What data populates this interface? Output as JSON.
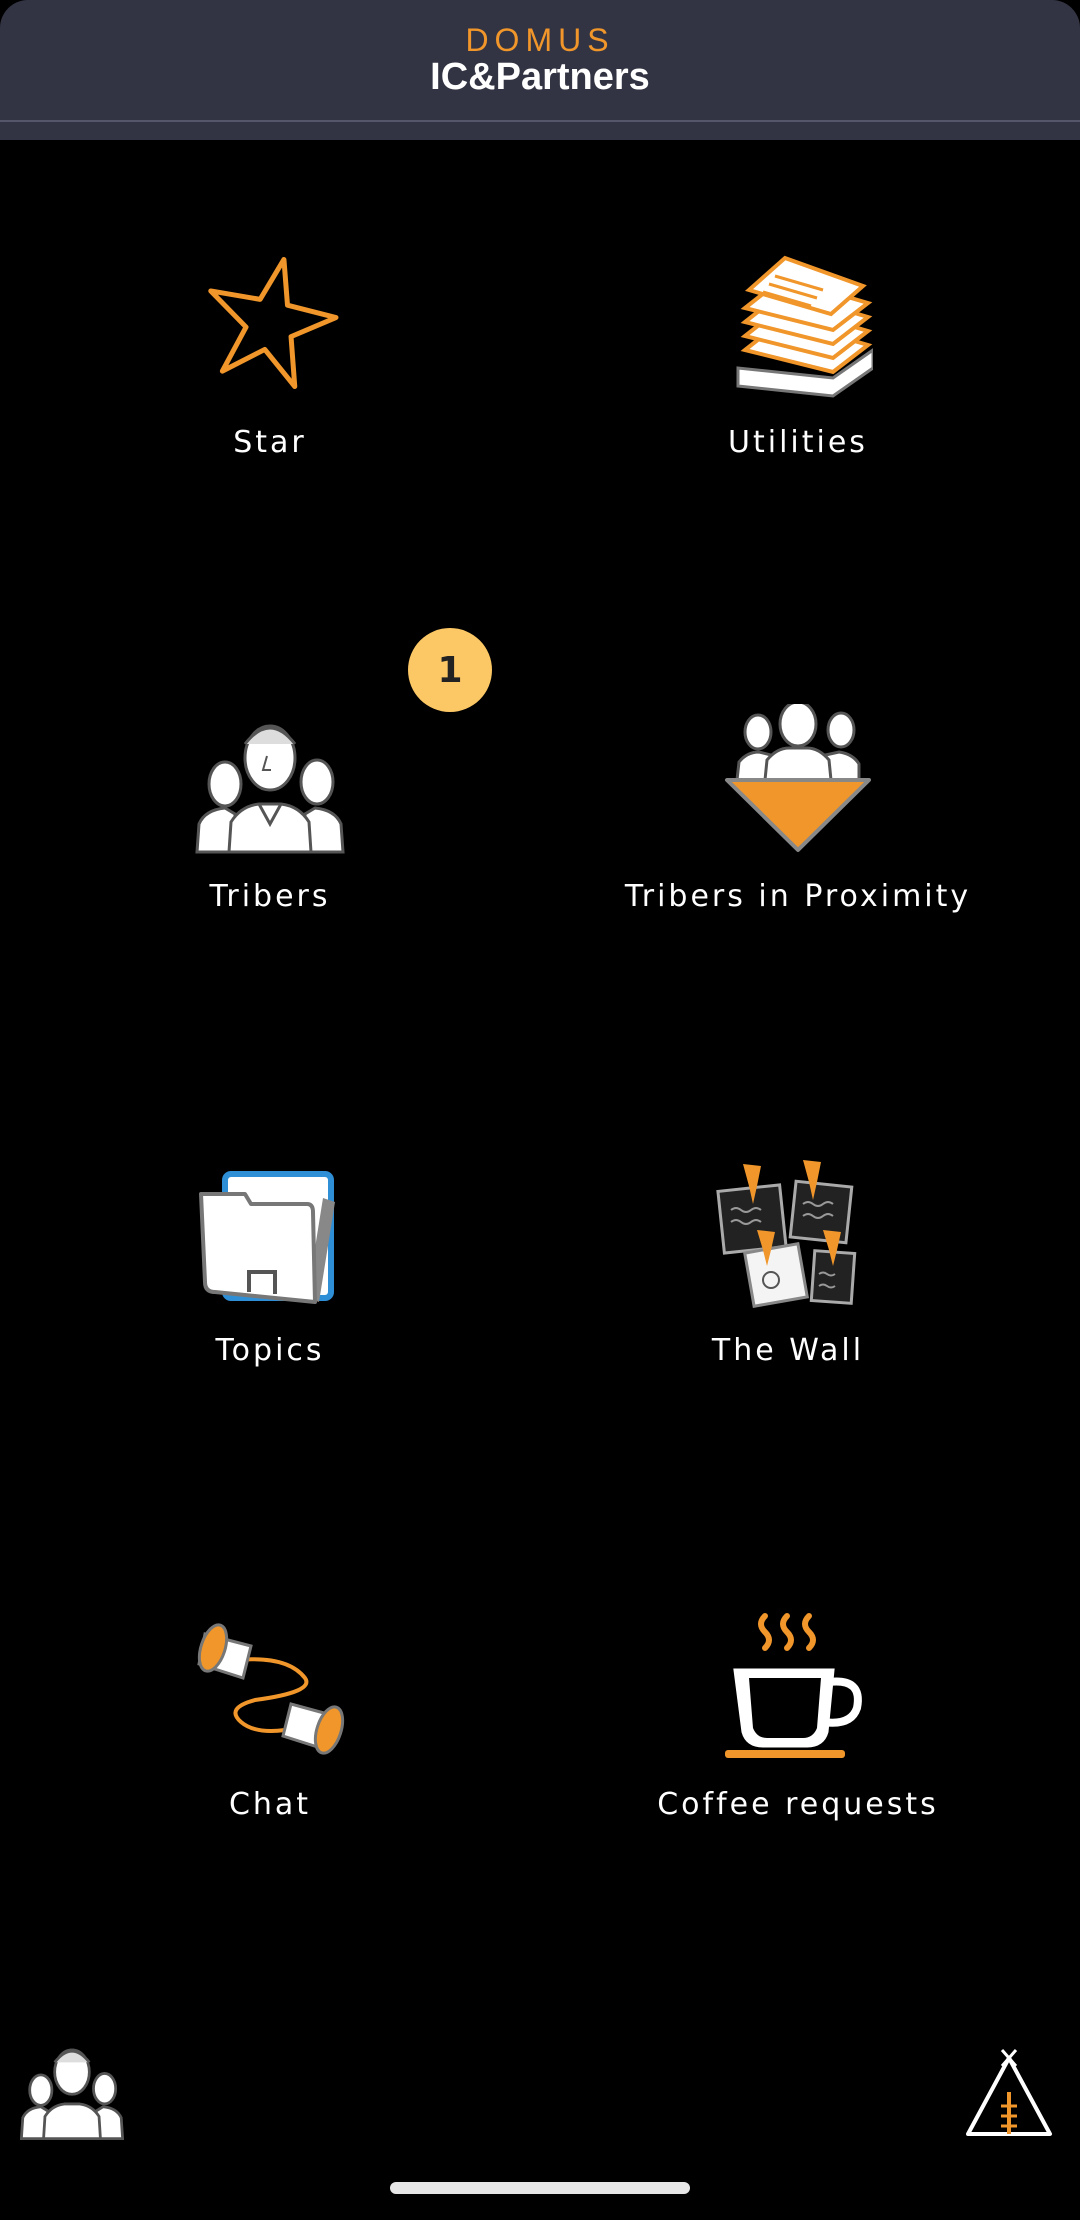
{
  "header": {
    "subtitle": "DOMUS",
    "title": "IC&Partners"
  },
  "tiles": [
    {
      "label": "Star"
    },
    {
      "label": "Utilities"
    },
    {
      "label": "Tribers"
    },
    {
      "label": "Tribers in Proximity"
    },
    {
      "label": "Topics"
    },
    {
      "label": "The Wall"
    },
    {
      "label": "Chat"
    },
    {
      "label": "Coffee requests"
    }
  ],
  "tribers_badge": "1",
  "icons": {
    "star": "star-icon",
    "utilities": "paper-stack-icon",
    "tribers": "people-group-icon",
    "proximity": "people-funnel-icon",
    "topics": "folder-icon",
    "wall": "pinned-notes-icon",
    "chat": "tin-can-phone-icon",
    "coffee": "coffee-cup-icon",
    "profile": "people-group-icon",
    "tent": "teepee-icon"
  },
  "colors": {
    "accent": "#f0962a",
    "header_bg": "#333443",
    "badge": "#fcc765"
  }
}
